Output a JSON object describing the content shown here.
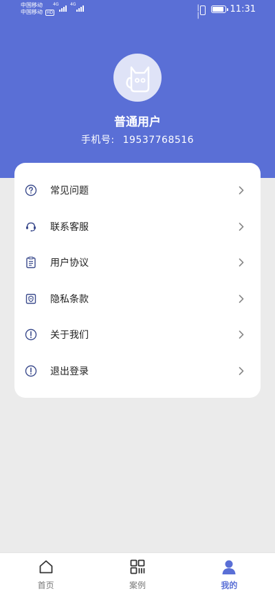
{
  "status_bar": {
    "carrier_1": "中国移动",
    "carrier_2": "中国移动",
    "hd": "HD",
    "network_1": "4G",
    "network_2": "4G",
    "time": "11:31"
  },
  "profile": {
    "username": "普通用户",
    "phone_label": "手机号:",
    "phone_number": "19537768516"
  },
  "menu": {
    "items": [
      {
        "label": "常见问题",
        "icon": "question-circle-icon"
      },
      {
        "label": "联系客服",
        "icon": "headset-icon"
      },
      {
        "label": "用户协议",
        "icon": "clipboard-icon"
      },
      {
        "label": "隐私条款",
        "icon": "privacy-shield-icon"
      },
      {
        "label": "关于我们",
        "icon": "info-circle-icon"
      },
      {
        "label": "退出登录",
        "icon": "info-circle-icon"
      }
    ]
  },
  "tabs": [
    {
      "label": "首页",
      "icon": "home-icon",
      "active": false
    },
    {
      "label": "案例",
      "icon": "qr-grid-icon",
      "active": false
    },
    {
      "label": "我的",
      "icon": "person-icon",
      "active": true
    }
  ],
  "colors": {
    "accent": "#5a6fd6",
    "background": "#ebebeb",
    "icon_blue": "#3a4a8c"
  }
}
